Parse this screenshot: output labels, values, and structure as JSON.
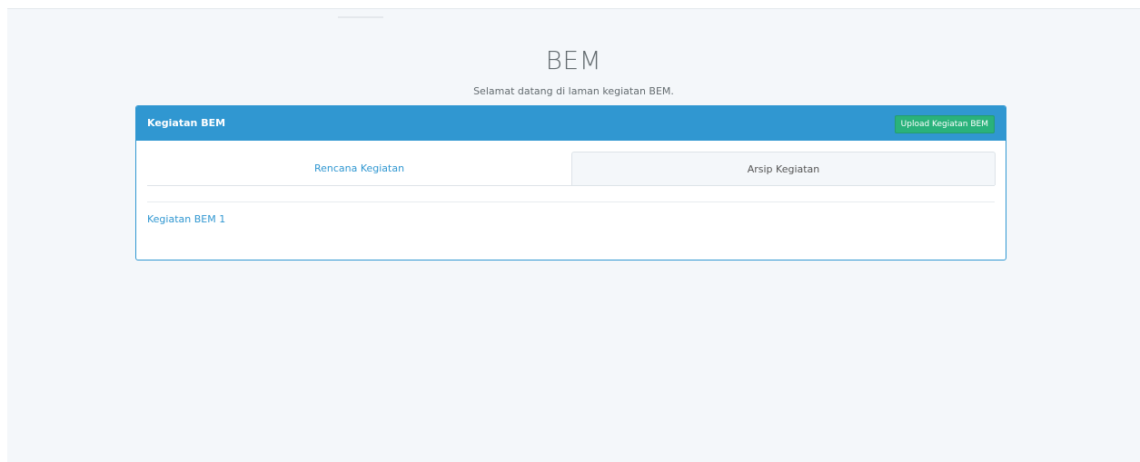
{
  "header": {
    "title": "BEM",
    "subtitle": "Selamat datang di laman kegiatan BEM."
  },
  "panel": {
    "title": "Kegiatan BEM",
    "upload_button_label": "Upload Kegiatan BEM"
  },
  "tabs": [
    {
      "label": "Rencana Kegiatan"
    },
    {
      "label": "Arsip Kegiatan"
    }
  ],
  "activities": [
    {
      "label": "Kegiatan BEM 1"
    }
  ],
  "colors": {
    "panel_heading": "#3097d1",
    "upload_button": "#2ab27b",
    "link": "#3097d1",
    "page_background": "#f4f7fa"
  }
}
